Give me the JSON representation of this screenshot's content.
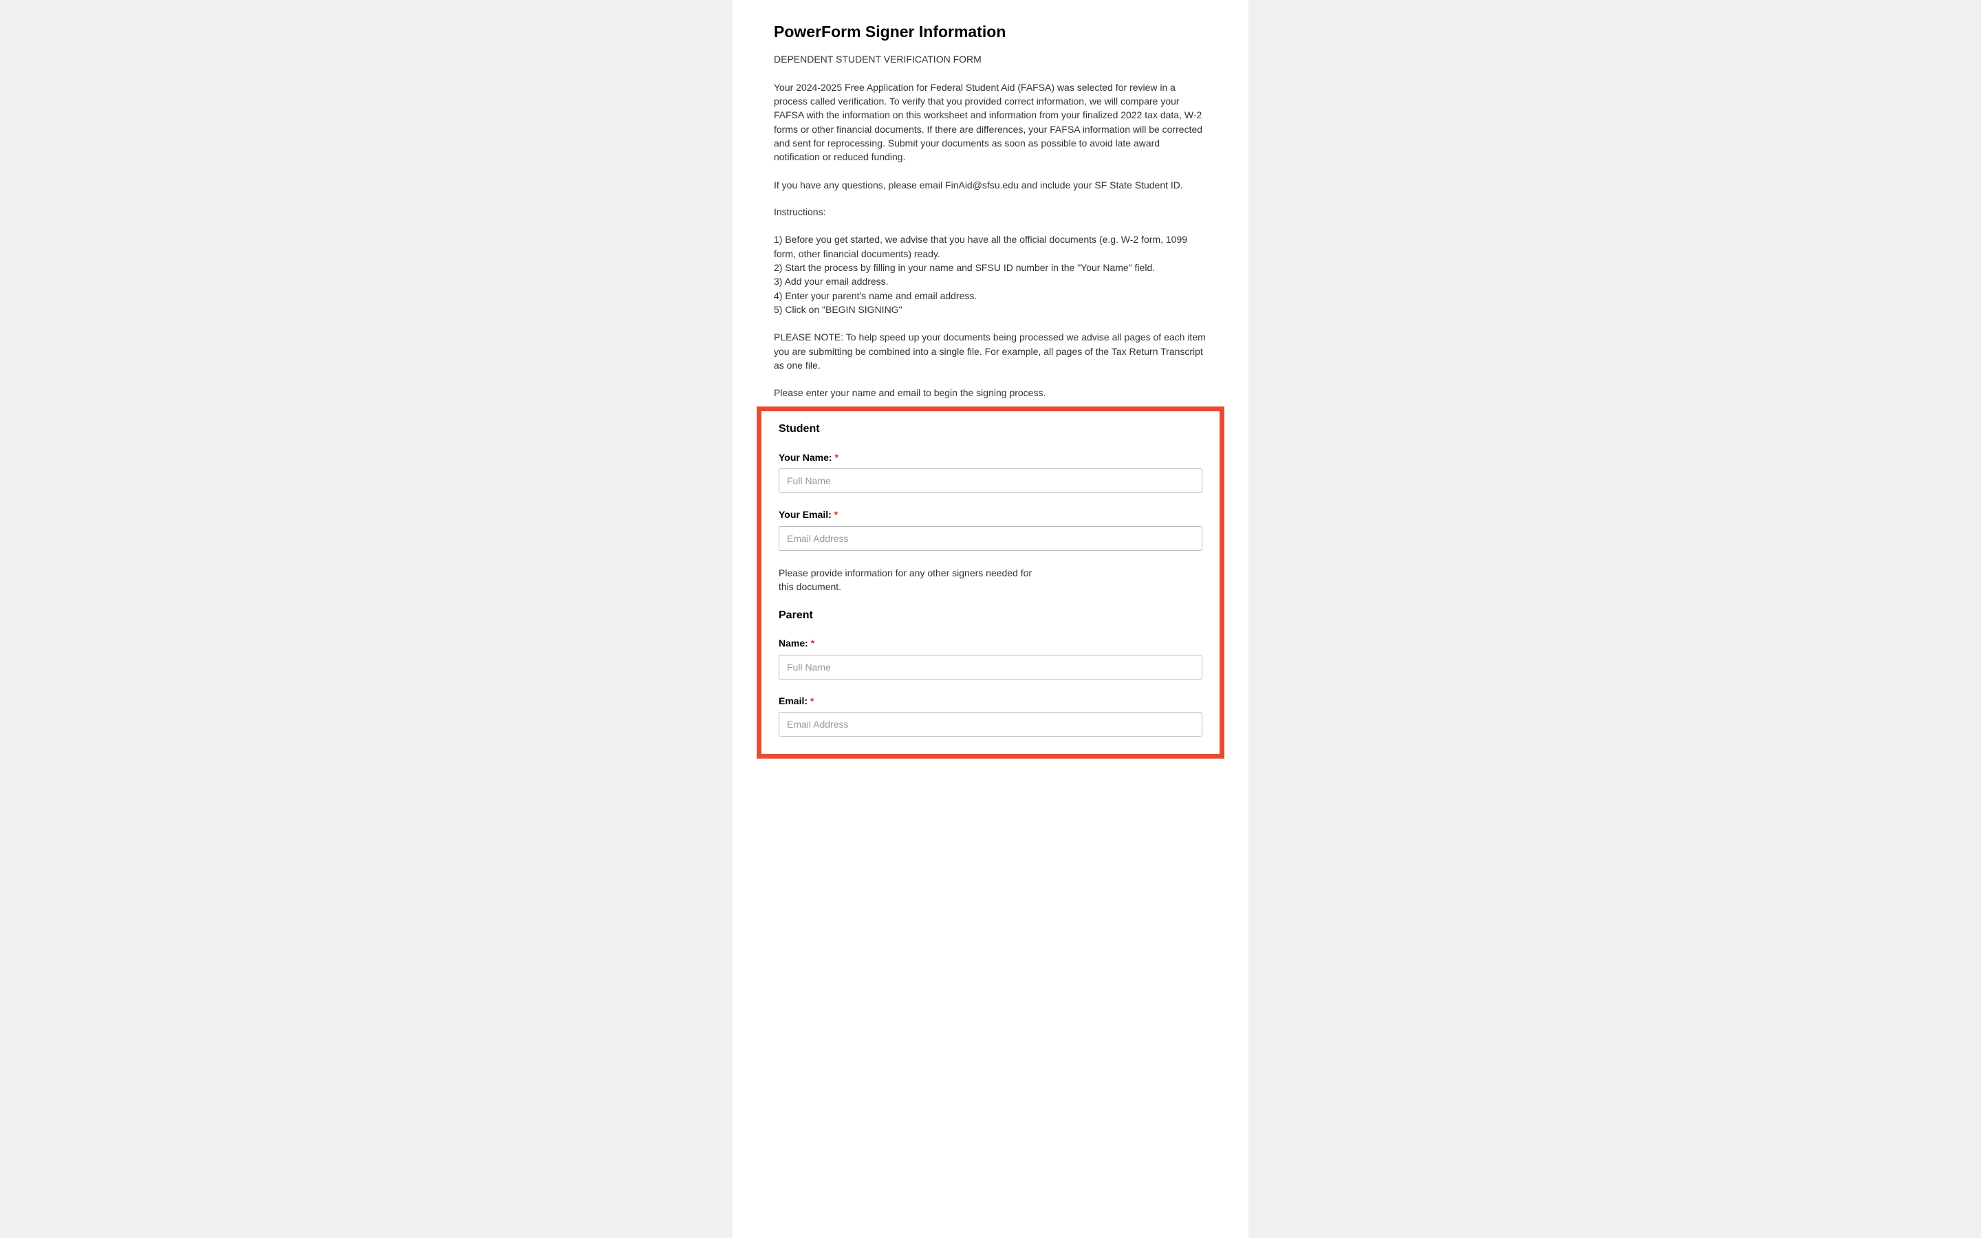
{
  "title": "PowerForm Signer Information",
  "subtitle": "DEPENDENT STUDENT VERIFICATION FORM",
  "intro_paragraph": "Your 2024-2025 Free Application for Federal Student Aid (FAFSA) was selected for review in a process called verification. To verify that you provided correct information, we will compare your FAFSA with the information on this worksheet and information from your finalized 2022 tax data, W-2 forms or other financial documents. If there are differences, your FAFSA information will be corrected and sent for reprocessing. Submit your documents as soon as possible to avoid late award notification or reduced funding.",
  "contact_paragraph": "If you have any questions, please email FinAid@sfsu.edu and include your SF State Student ID.",
  "instructions_header": "Instructions:",
  "instructions": {
    "step1": "1) Before you get started, we advise that you have all the official documents (e.g. W-2 form, 1099 form, other financial documents) ready.",
    "step2": "2) Start the process by filling in your name and SFSU ID number in the \"Your Name\" field.",
    "step3": "3) Add your email address.",
    "step4": "4) Enter your parent's name and email address.",
    "step5": "5) Click on \"BEGIN SIGNING\""
  },
  "note_paragraph": "PLEASE NOTE: To help speed up your documents being processed we advise all pages of each item you are submitting be combined into a single file. For example, all pages of the Tax Return Transcript as one file.",
  "prompt_paragraph": "Please enter your name and email to begin the signing process.",
  "form": {
    "student": {
      "section_title": "Student",
      "name_label": "Your Name: ",
      "name_placeholder": "Full Name",
      "email_label": "Your Email: ",
      "email_placeholder": "Email Address"
    },
    "helper_text": "Please provide information for any other signers needed for this document.",
    "parent": {
      "section_title": "Parent",
      "name_label": "Name: ",
      "name_placeholder": "Full Name",
      "email_label": "Email: ",
      "email_placeholder": "Email Address"
    },
    "required_mark": "*"
  }
}
